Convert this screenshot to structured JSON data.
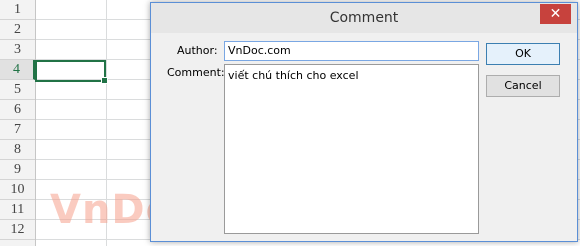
{
  "spreadsheet": {
    "row_numbers": [
      "1",
      "2",
      "3",
      "4",
      "5",
      "6",
      "7",
      "8",
      "9",
      "10",
      "11",
      "12"
    ],
    "selected_row": "4"
  },
  "dialog": {
    "title": "Comment",
    "close_glyph": "✕",
    "author_label": "Author:",
    "author_value": "VnDoc.com",
    "comment_label": "Comment:",
    "comment_value": "viết chú thích cho excel",
    "ok_label": "OK",
    "cancel_label": "Cancel"
  },
  "watermark": "VnDoc.com",
  "colors": {
    "selection_green": "#217346",
    "close_red": "#c7423d",
    "focus_blue": "#7aa7e3"
  }
}
